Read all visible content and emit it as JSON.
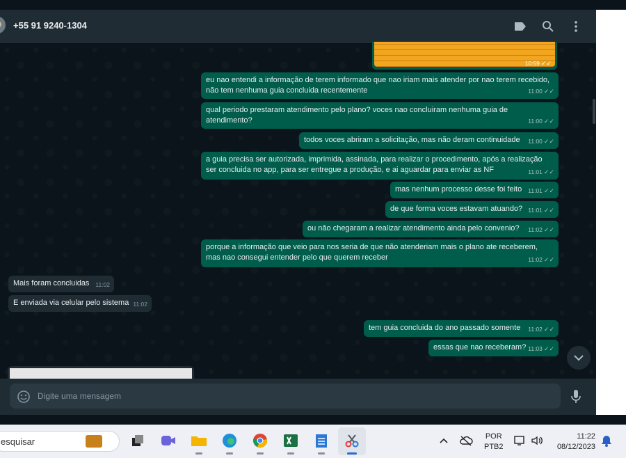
{
  "header": {
    "contact_name": "+55 91 9240-1304",
    "icons": [
      "label-icon",
      "search-icon",
      "menu-icon"
    ]
  },
  "image_message": {
    "time": "10:59",
    "status": "read"
  },
  "messages": [
    {
      "dir": "out",
      "text": "eu nao entendi a informação de terem informado que nao iriam mais atender por nao terem recebido, não tem nenhuma guia concluida recentemente",
      "time": "11:00"
    },
    {
      "dir": "out",
      "text": "qual periodo prestaram atendimento pelo plano? voces nao concluiram nenhuma guia de atendimento?",
      "time": "11:00"
    },
    {
      "dir": "out",
      "text": "todos voces abriram a solicitação, mas não deram continuidade",
      "time": "11:00"
    },
    {
      "dir": "out",
      "text": "a guia precisa ser autorizada, imprimida, assinada, para realizar o procedimento, após a realização ser concluida no app, para ser entregue a produção, e ai aguardar para enviar as NF",
      "time": "11:01"
    },
    {
      "dir": "out",
      "text": "mas nenhum processo desse foi feito",
      "time": "11:01"
    },
    {
      "dir": "out",
      "text": "de que forma voces estavam atuando?",
      "time": "11:01"
    },
    {
      "dir": "out",
      "text": "ou não chegaram a realizar atendimento ainda pelo convenio?",
      "time": "11:02"
    },
    {
      "dir": "out",
      "text": "porque a informação que veio para nos seria de que não atenderiam mais o plano ate receberem, mas nao consegui entender pelo que querem receber",
      "time": "11:02"
    },
    {
      "dir": "in",
      "text": "Mais foram concluidas",
      "time": "11:02"
    },
    {
      "dir": "in",
      "text": "E enviada via celular pelo sistema",
      "time": "11:02"
    },
    {
      "dir": "out",
      "text": "tem guia concluida do ano passado somente",
      "time": "11:02"
    },
    {
      "dir": "out",
      "text": "essas que nao receberam?",
      "time": "11:03"
    }
  ],
  "composer": {
    "placeholder": "Digite uma mensagem"
  },
  "taskbar": {
    "search_text": "esquisar",
    "language": "POR",
    "layout": "PTB2",
    "time": "11:22",
    "date": "08/12/2023"
  },
  "colors": {
    "outgoing_bubble": "#005c4b",
    "incoming_bubble": "#202c33",
    "chat_bg": "#0b141a",
    "header_bg": "#202c33"
  }
}
